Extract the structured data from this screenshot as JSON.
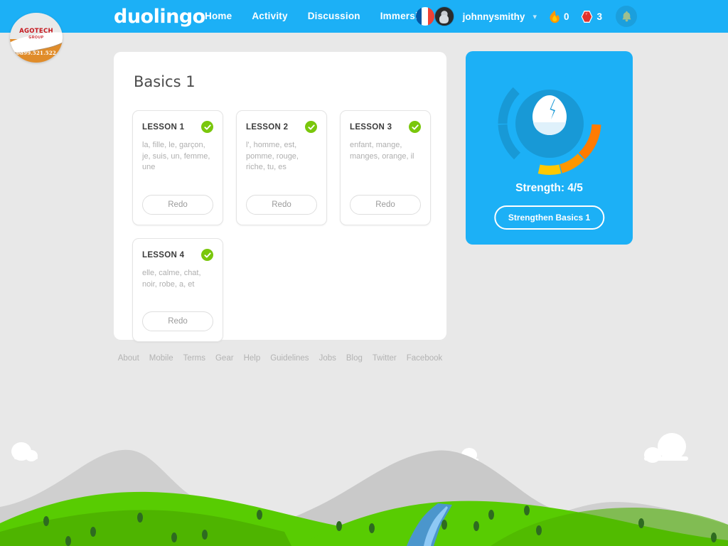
{
  "navbar": {
    "logo": "duolingo",
    "links": [
      {
        "label": "Home",
        "name": "nav-link-home"
      },
      {
        "label": "Activity",
        "name": "nav-link-activity"
      },
      {
        "label": "Discussion",
        "name": "nav-link-discussion"
      },
      {
        "label": "Immersion",
        "name": "nav-link-immersion"
      }
    ],
    "flag_icon": "french-flag-icon",
    "avatar_icon": "user-avatar",
    "username": "johnnysmithy",
    "dropdown_icon": "chevron-down-icon",
    "streak": {
      "icon": "flame-icon",
      "value": "0"
    },
    "lingots": {
      "icon": "ruby-gem-icon",
      "value": "3"
    },
    "notifications_icon": "bell-icon",
    "bg_color": "#1cb0f6"
  },
  "watermark": {
    "brand": "AGOTECH",
    "sub": "GROUP",
    "phone": "0899.521.522",
    "phone_icon": "phone-icon"
  },
  "main": {
    "skill_title": "Basics 1",
    "lessons": [
      {
        "name": "LESSON 1",
        "words": "la, fille, le, garçon, je, suis, un, femme, une",
        "status_icon": "check-circle-icon",
        "completed": true,
        "action": "Redo"
      },
      {
        "name": "LESSON 2",
        "words": "l', homme, est, pomme, rouge, riche, tu, es",
        "status_icon": "check-circle-icon",
        "completed": true,
        "action": "Redo"
      },
      {
        "name": "LESSON 3",
        "words": "enfant, mange, manges, orange, il",
        "status_icon": "check-circle-icon",
        "completed": true,
        "action": "Redo"
      },
      {
        "name": "LESSON 4",
        "words": "elle, calme, chat, noir, robe, a, et",
        "status_icon": "check-circle-icon",
        "completed": true,
        "action": "Redo"
      }
    ]
  },
  "strength_panel": {
    "icon": "cracked-egg-icon",
    "label": "Strength: 4/5",
    "value": 4,
    "max": 5,
    "button_label": "Strengthen Basics 1",
    "ring_colors": {
      "filled": "#1899d6",
      "warn": "#ffc800",
      "warn2": "#ff9600",
      "alert": "#ff7b00",
      "empty": "#ff5b3d"
    }
  },
  "footer": {
    "links": [
      "About",
      "Mobile",
      "Terms",
      "Gear",
      "Help",
      "Guidelines",
      "Jobs",
      "Blog",
      "Twitter",
      "Facebook"
    ]
  },
  "colors": {
    "page_bg": "#e8e8e8",
    "brand_blue": "#1cb0f6",
    "green": "#7ac70c",
    "hill_green": "#58cc02",
    "mountain_gray": "#cfcfcf"
  }
}
